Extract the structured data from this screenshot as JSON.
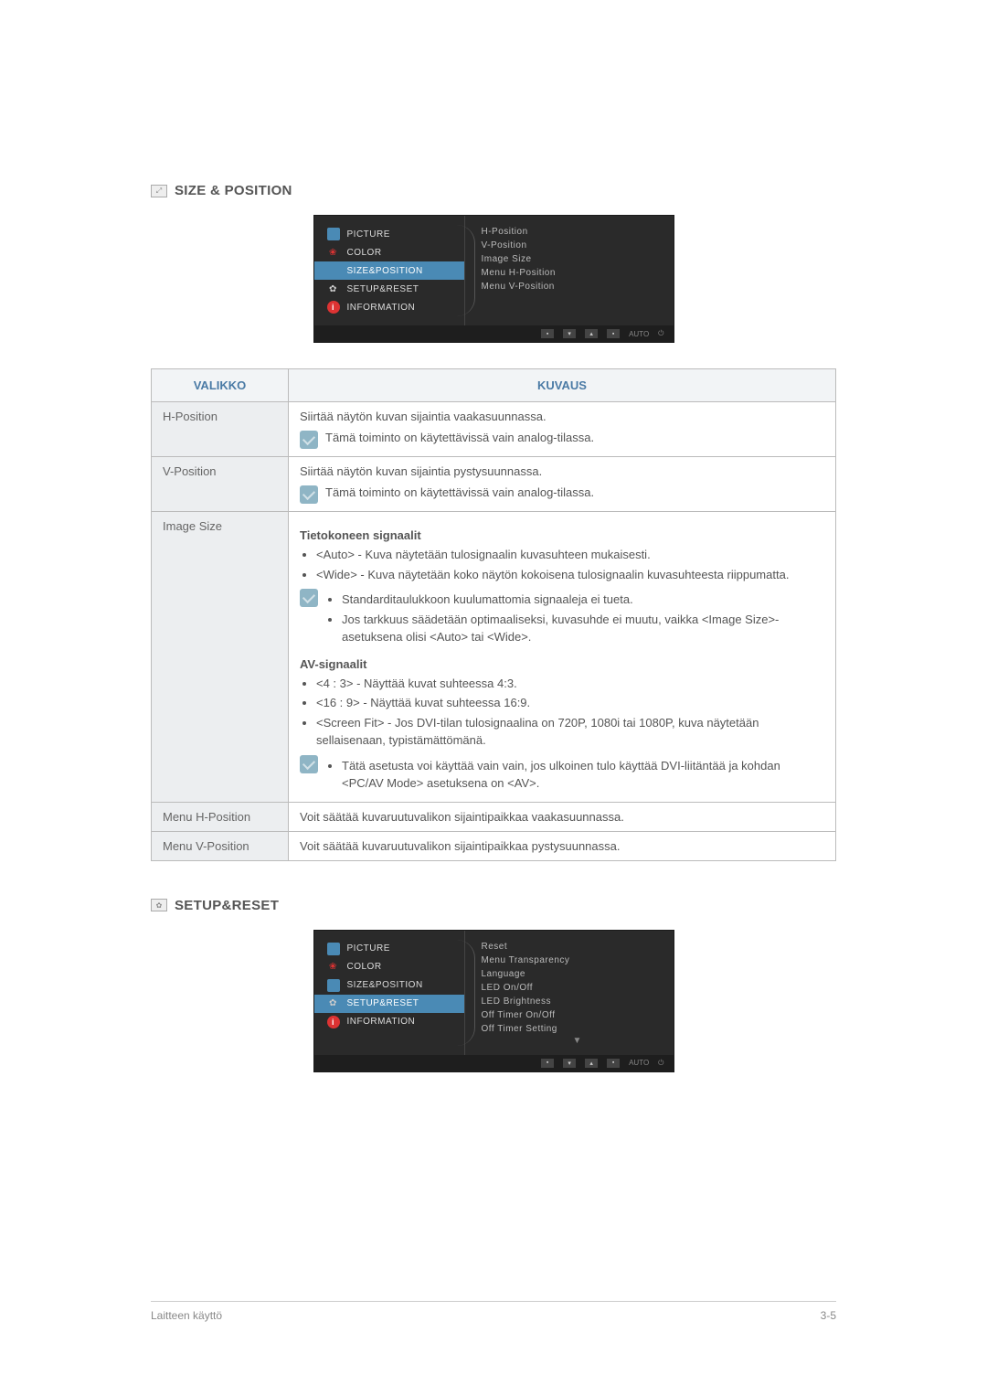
{
  "section1": {
    "title": "SIZE & POSITION",
    "osd": {
      "left": [
        "PICTURE",
        "COLOR",
        "SIZE&POSITION",
        "SETUP&RESET",
        "INFORMATION"
      ],
      "right": [
        "H-Position",
        "V-Position",
        "Image Size",
        "Menu H-Position",
        "Menu V-Position"
      ],
      "bottom": {
        "auto": "AUTO"
      }
    }
  },
  "table": {
    "head": {
      "menu": "VALIKKO",
      "desc": "KUVAUS"
    },
    "rows": {
      "hpos": {
        "label": "H-Position",
        "text": "Siirtää näytön kuvan sijaintia vaakasuunnassa.",
        "note": "Tämä toiminto on käytettävissä vain analog-tilassa."
      },
      "vpos": {
        "label": "V-Position",
        "text": "Siirtää näytön kuvan sijaintia pystysuunnassa.",
        "note": "Tämä toiminto on käytettävissä vain analog-tilassa."
      },
      "imgsize": {
        "label": "Image Size",
        "sub1_title": "Tietokoneen signaalit",
        "b1": "<Auto> - Kuva näytetään tulosignaalin kuvasuhteen mukaisesti.",
        "b2": "<Wide> - Kuva näytetään koko näytön kokoisena tulosignaalin kuvasuhteesta riippumatta.",
        "note_b1": "Standarditaulukkoon kuulumattomia signaaleja ei tueta.",
        "note_b2": "Jos tarkkuus säädetään optimaaliseksi, kuvasuhde ei muutu, vaikka <Image Size>-asetuksena olisi <Auto> tai <Wide>.",
        "sub2_title": "AV-signaalit",
        "b3": "<4 : 3> - Näyttää kuvat suhteessa 4:3.",
        "b4": "<16 : 9> - Näyttää kuvat suhteessa 16:9.",
        "b5": "<Screen Fit> - Jos DVI-tilan tulosignaalina on 720P, 1080i tai 1080P, kuva näytetään sellaisenaan, typistämättömänä.",
        "note2_b1": "Tätä asetusta voi käyttää vain vain, jos ulkoinen tulo käyttää DVI-liitäntää ja kohdan <PC/AV Mode> asetuksena on <AV>."
      },
      "menuh": {
        "label": "Menu H-Position",
        "text": "Voit säätää kuvaruutuvalikon sijaintipaikkaa vaakasuunnassa."
      },
      "menuv": {
        "label": "Menu V-Position",
        "text": "Voit säätää kuvaruutuvalikon sijaintipaikkaa pystysuunnassa."
      }
    }
  },
  "section2": {
    "title": "SETUP&RESET",
    "osd": {
      "left": [
        "PICTURE",
        "COLOR",
        "SIZE&POSITION",
        "SETUP&RESET",
        "INFORMATION"
      ],
      "right": [
        "Reset",
        "Menu Transparency",
        "Language",
        "LED On/Off",
        "LED Brightness",
        "Off Timer On/Off",
        "Off Timer Setting"
      ],
      "bottom": {
        "auto": "AUTO"
      }
    }
  },
  "footer": {
    "left": "Laitteen käyttö",
    "right": "3-5"
  }
}
